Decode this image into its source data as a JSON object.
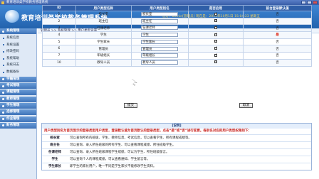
{
  "window": {
    "title": "教育培训类学校教务管理系统"
  },
  "header": {
    "system_name": "教育培训类学校教务管理系统",
    "info_line1": "您好：admin[管理员]   现在是：2011年10月1日 15:04:23 星期五",
    "info_line2": "[当前登录学期：2009第二学期] [返回首页] [修改密码] [注销登录]"
  },
  "sidebar": {
    "system_header": "系统管理",
    "system_items": [
      "系统信息",
      "系统设置",
      "修改密码",
      "系统帮助",
      "系统日志",
      "数据备份"
    ],
    "module_headers": [
      "学籍管理",
      "考试管理",
      "课程管理",
      "教师管理",
      "学生管理",
      "选修管理",
      "作业管理",
      "财务管理"
    ]
  },
  "breadcrumb": "管理员 >> 系统管理 >> 用户类型设置",
  "table": {
    "headers": [
      "ID",
      "用户类型名称",
      "用户类型别名",
      "是否启用",
      "前台登录默认值"
    ],
    "rows": [
      {
        "id": "1",
        "name": "校长室",
        "alias": "校长室",
        "enabled": true,
        "default": "否",
        "default_red": false
      },
      {
        "id": "2",
        "name": "班主任",
        "alias": "班主任",
        "enabled": true,
        "default": "否",
        "default_red": false
      },
      {
        "id": "3",
        "name": "任课老师",
        "alias": "任课老师",
        "enabled": true,
        "default": "否",
        "default_red": false
      },
      {
        "id": "4",
        "name": "学生",
        "alias": "学生",
        "enabled": true,
        "default": "是",
        "default_red": true
      },
      {
        "id": "5",
        "name": "学生家长",
        "alias": "学生家长",
        "enabled": true,
        "default": "否",
        "default_red": false
      },
      {
        "id": "6",
        "name": "管理员",
        "alias": "管理员",
        "enabled": true,
        "default": "否",
        "default_red": false
      },
      {
        "id": "7",
        "name": "年级组长",
        "alias": "年级组长",
        "enabled": true,
        "default": "否",
        "default_red": false
      },
      {
        "id": "10",
        "name": "教导人员",
        "alias": "教导人员",
        "enabled": true,
        "default": "否",
        "default_red": false
      }
    ]
  },
  "buttons": {
    "submit": "提交",
    "cancel": "取消"
  },
  "note": {
    "title": "[说明]",
    "red_text": "用户类型别名为首页显示的登录类型用户类型，登录默认值为首页默认的登录类型，点击“是”或“否”进行变更。各别名对应的用户类型权限如下：",
    "roles": [
      {
        "role": "校长室",
        "desc": "可以查询所有的班级、学生、教师信息，考试信息，可以查看学生、所有课程成绩等。"
      },
      {
        "role": "班主任",
        "desc": "可以查询、录入所任班级的所有学生、可以查看课程成绩、所任班级学生。"
      },
      {
        "role": "任课老师",
        "desc": "可以查询、录入所任班级课程学生成绩，可以为学生、所任班级留言。"
      },
      {
        "role": "学生",
        "desc": "可以查询个人的课程成绩，可以查看通知、学生留言等。"
      },
      {
        "role": "学生家长",
        "desc": "即学生的家长用户，唯一不同是学生家长不能修改学生资料。"
      }
    ]
  },
  "colors": {
    "header_blue": "#2262ad",
    "table_header": "#2f5ea7",
    "note_red": "#c8201c"
  }
}
